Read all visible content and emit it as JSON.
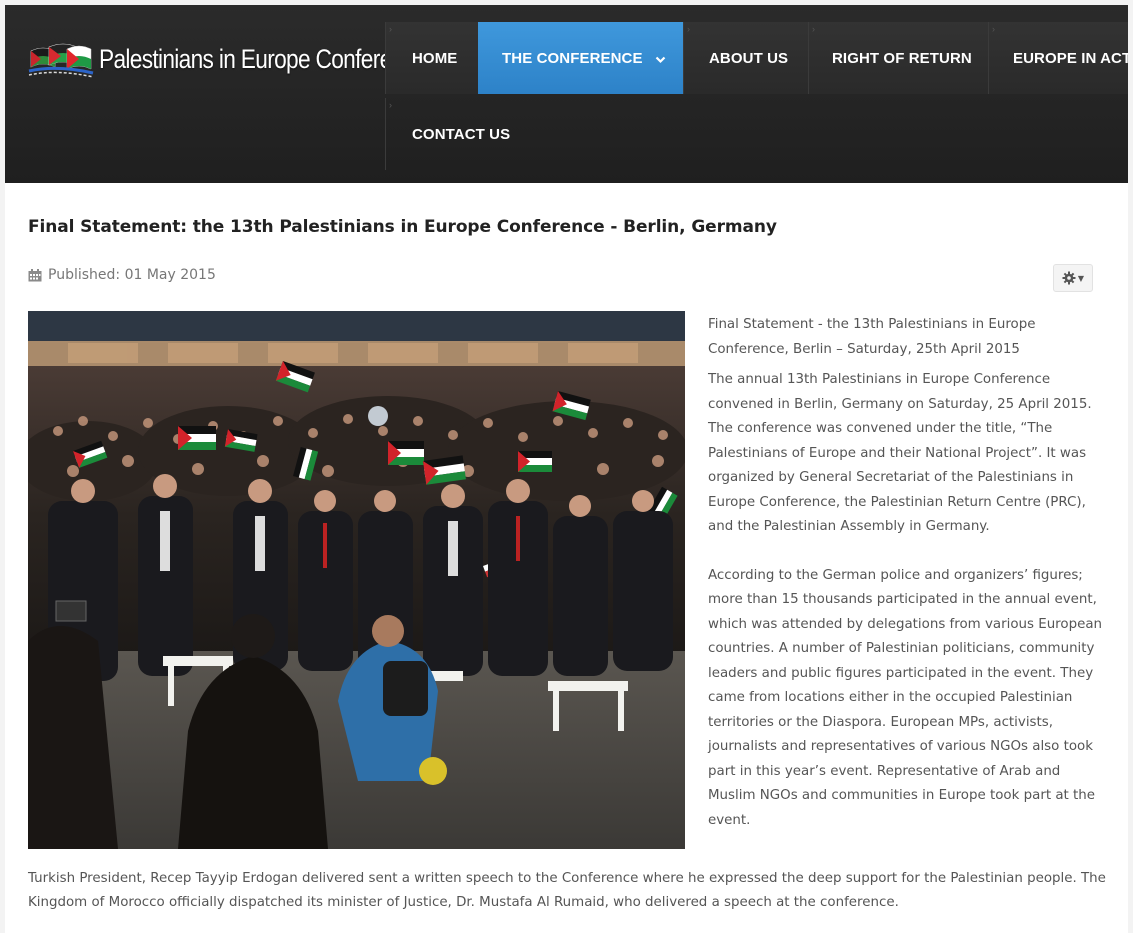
{
  "site": {
    "logo_text": "Palestinians in Europe Conference"
  },
  "nav": {
    "items": [
      {
        "label": "HOME"
      },
      {
        "label": "THE CONFERENCE"
      },
      {
        "label": "ABOUT US"
      },
      {
        "label": "RIGHT OF RETURN"
      },
      {
        "label": "EUROPE IN ACTI"
      },
      {
        "label": "CONTACT US"
      }
    ],
    "active_index": 1
  },
  "article": {
    "title": "Final Statement: the 13th Palestinians in Europe Conference - Berlin, Germany",
    "published": "Published: 01 May 2015",
    "intro": "Final Statement - the 13th Palestinians in Europe Conference, Berlin – Saturday, 25th April 2015",
    "para1": "The annual 13th Palestinians in Europe Conference convened in Berlin, Germany on Saturday, 25 April 2015. The conference was convened under the title, “The Palestinians of Europe and their National Project”.  It was organized by General Secretariat of the Palestinians in Europe Conference, the Palestinian Return Centre (PRC), and the Palestinian Assembly in Germany.",
    "para2": "According to the German police and organizers’ figures; more than 15 thousands participated in the annual event, which was attended by delegations from various European countries.  A number of Palestinian politicians, community leaders and public figures participated in the event.  They came from locations either in the occupied Palestinian territories or the Diaspora. European MPs, activists, journalists and representatives of various NGOs also took part in this year’s event.  Representative of Arab and Muslim NGOs and communities in Europe took part at the event.",
    "para3": "Turkish President, Recep Tayyip Erdogan delivered sent a written speech to the Conference where he expressed the deep support for the Palestinian people. The Kingdom of Morocco officially dispatched its minister of Justice, Dr. Mustafa Al Rumaid, who delivered a speech at the conference."
  },
  "icons": {
    "calendar": "calendar-icon",
    "gear": "gear-icon",
    "chevron": "chevron-down-icon"
  },
  "colors": {
    "header_bg": "#262626",
    "nav_active": "#3a8fd6",
    "title": "#222222",
    "body_text": "#555555"
  }
}
